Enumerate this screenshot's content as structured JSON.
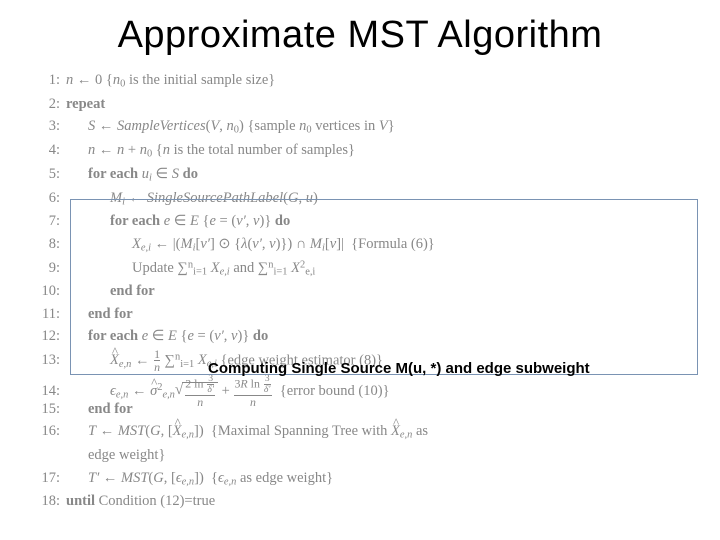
{
  "title": "Approximate MST Algorithm",
  "annot": "Computing Single Source M(u, *) and edge subweight",
  "lines": {
    "l1": "<span class='it'>n</span> ← 0 {<span class='it'>n</span><sub>0</sub> is the initial sample size}",
    "l2": "<span class='bf'>repeat</span>",
    "l3": "<span class='it'>S</span> ← <span class='it'>SampleVertices</span>(<span class='it'>V</span>, <span class='it'>n</span><sub>0</sub>) {sample <span class='it'>n</span><sub>0</sub> vertices in <span class='it'>V</span>}",
    "l4": "<span class='it'>n</span> ← <span class='it'>n</span> + <span class='it'>n</span><sub>0</sub> {<span class='it'>n</span> is the total number of samples}",
    "l5": "<span class='bf'>for each</span> <span class='it'>u<sub>i</sub></span> ∈ <span class='it'>S</span> <span class='bf'>do</span>",
    "l6": "<span class='it'>M<sub>i</sub></span> ← <span class='it'>SingleSourcePathLabel</span>(<span class='it'>G</span>, <span class='it'>u</span>)",
    "l7": "<span class='bf'>for each</span> <span class='it'>e</span> ∈ <span class='it'>E</span> {<span class='it'>e</span> = (<span class='it'>v′</span>, <span class='it'>v</span>)} <span class='bf'>do</span>",
    "l8": "<span class='it'>X<sub>e,i</sub></span> ← |(<span class='it'>M<sub>i</sub></span>[<span class='it'>v′</span>] ⊙ {<span class='it'>λ</span>(<span class='it'>v′</span>, <span class='it'>v</span>)}) ∩ <span class='it'>M<sub>i</sub></span>[<span class='it'>v</span>]|&nbsp;&nbsp;{Formula (6)}",
    "l9": "Update ∑<sup>n</sup><sub>i=1</sub> <span class='it'>X<sub>e,i</sub></span> and ∑<sup>n</sup><sub>i=1</sub> <span class='it'>X</span><sup>2</sup><sub>e,i</sub>",
    "l10": "<span class='bf'>end for</span>",
    "l11": "<span class='bf'>end for</span>",
    "l12": "<span class='bf'>for each</span> <span class='it'>e</span> ∈ <span class='it'>E</span> {<span class='it'>e</span> = (<span class='it'>v′</span>, <span class='it'>v</span>)} <span class='bf'>do</span>",
    "l13": "<span class='hat it'>X</span><sub><span class='it'>e,n</span></sub> ← <span class='frac'><span class='fn'>1</span><span class='fd'><span class='it'>n</span></span></span> ∑<sup>n</sup><sub>i=1</sub> <span class='it'>X<sub>e,i</sub></span> {edge weight estimator (8)}",
    "l14": "<span class='it'>ϵ<sub>e,n</sub></span> ← <span class='hat it'>σ</span><sup>2</sup><sub><span class='it'>e,n</span></sub><span class='surd'>√</span><span class='sqrt'><span class='frac'><span class='fn'>2 ln <span class='frac'><span class='fn'>3</span><span class='fd'><span class='it'>δ′</span></span></span></span><span class='fd'><span class='it'>n</span></span></span></span> + <span class='frac'><span class='fn'>3<span class='it'>R</span> ln <span class='frac'><span class='fn'>3</span><span class='fd'><span class='it'>δ′</span></span></span></span><span class='fd'><span class='it'>n</span></span></span>&nbsp;&nbsp;{error bound (10)}",
    "l15": "<span class='bf'>end for</span>",
    "l16": "<span class='it'>T</span> ← <span class='it'>MST</span>(<span class='it'>G</span>, [<span class='hat it'>X</span><sub><span class='it'>e,n</span></sub>])&nbsp;&nbsp;{Maximal Spanning Tree with <span class='hat it'>X</span><sub><span class='it'>e,n</span></sub> as",
    "l16b": "edge weight}",
    "l17": "<span class='it'>T′</span> ← <span class='it'>MST</span>(<span class='it'>G</span>, [<span class='it'>ϵ<sub>e,n</sub></span>])&nbsp;&nbsp;{<span class='it'>ϵ<sub>e,n</sub></span> as edge weight}",
    "l18": "<span class='bf'>until</span> Condition (12)=true"
  }
}
